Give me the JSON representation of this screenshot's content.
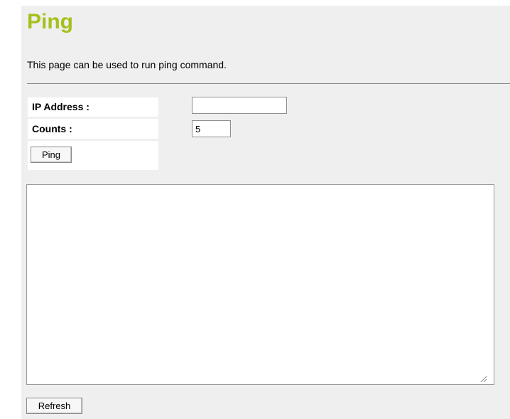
{
  "page": {
    "title": "Ping",
    "description": "This page can be used to run ping command."
  },
  "form": {
    "ip_label": "IP Address :",
    "ip_value": "",
    "counts_label": "Counts :",
    "counts_value": "5",
    "ping_button": "Ping"
  },
  "output": {
    "text": ""
  },
  "refresh_button": "Refresh",
  "colors": {
    "title": "#a4c11b",
    "panel_background": "#efefef"
  }
}
